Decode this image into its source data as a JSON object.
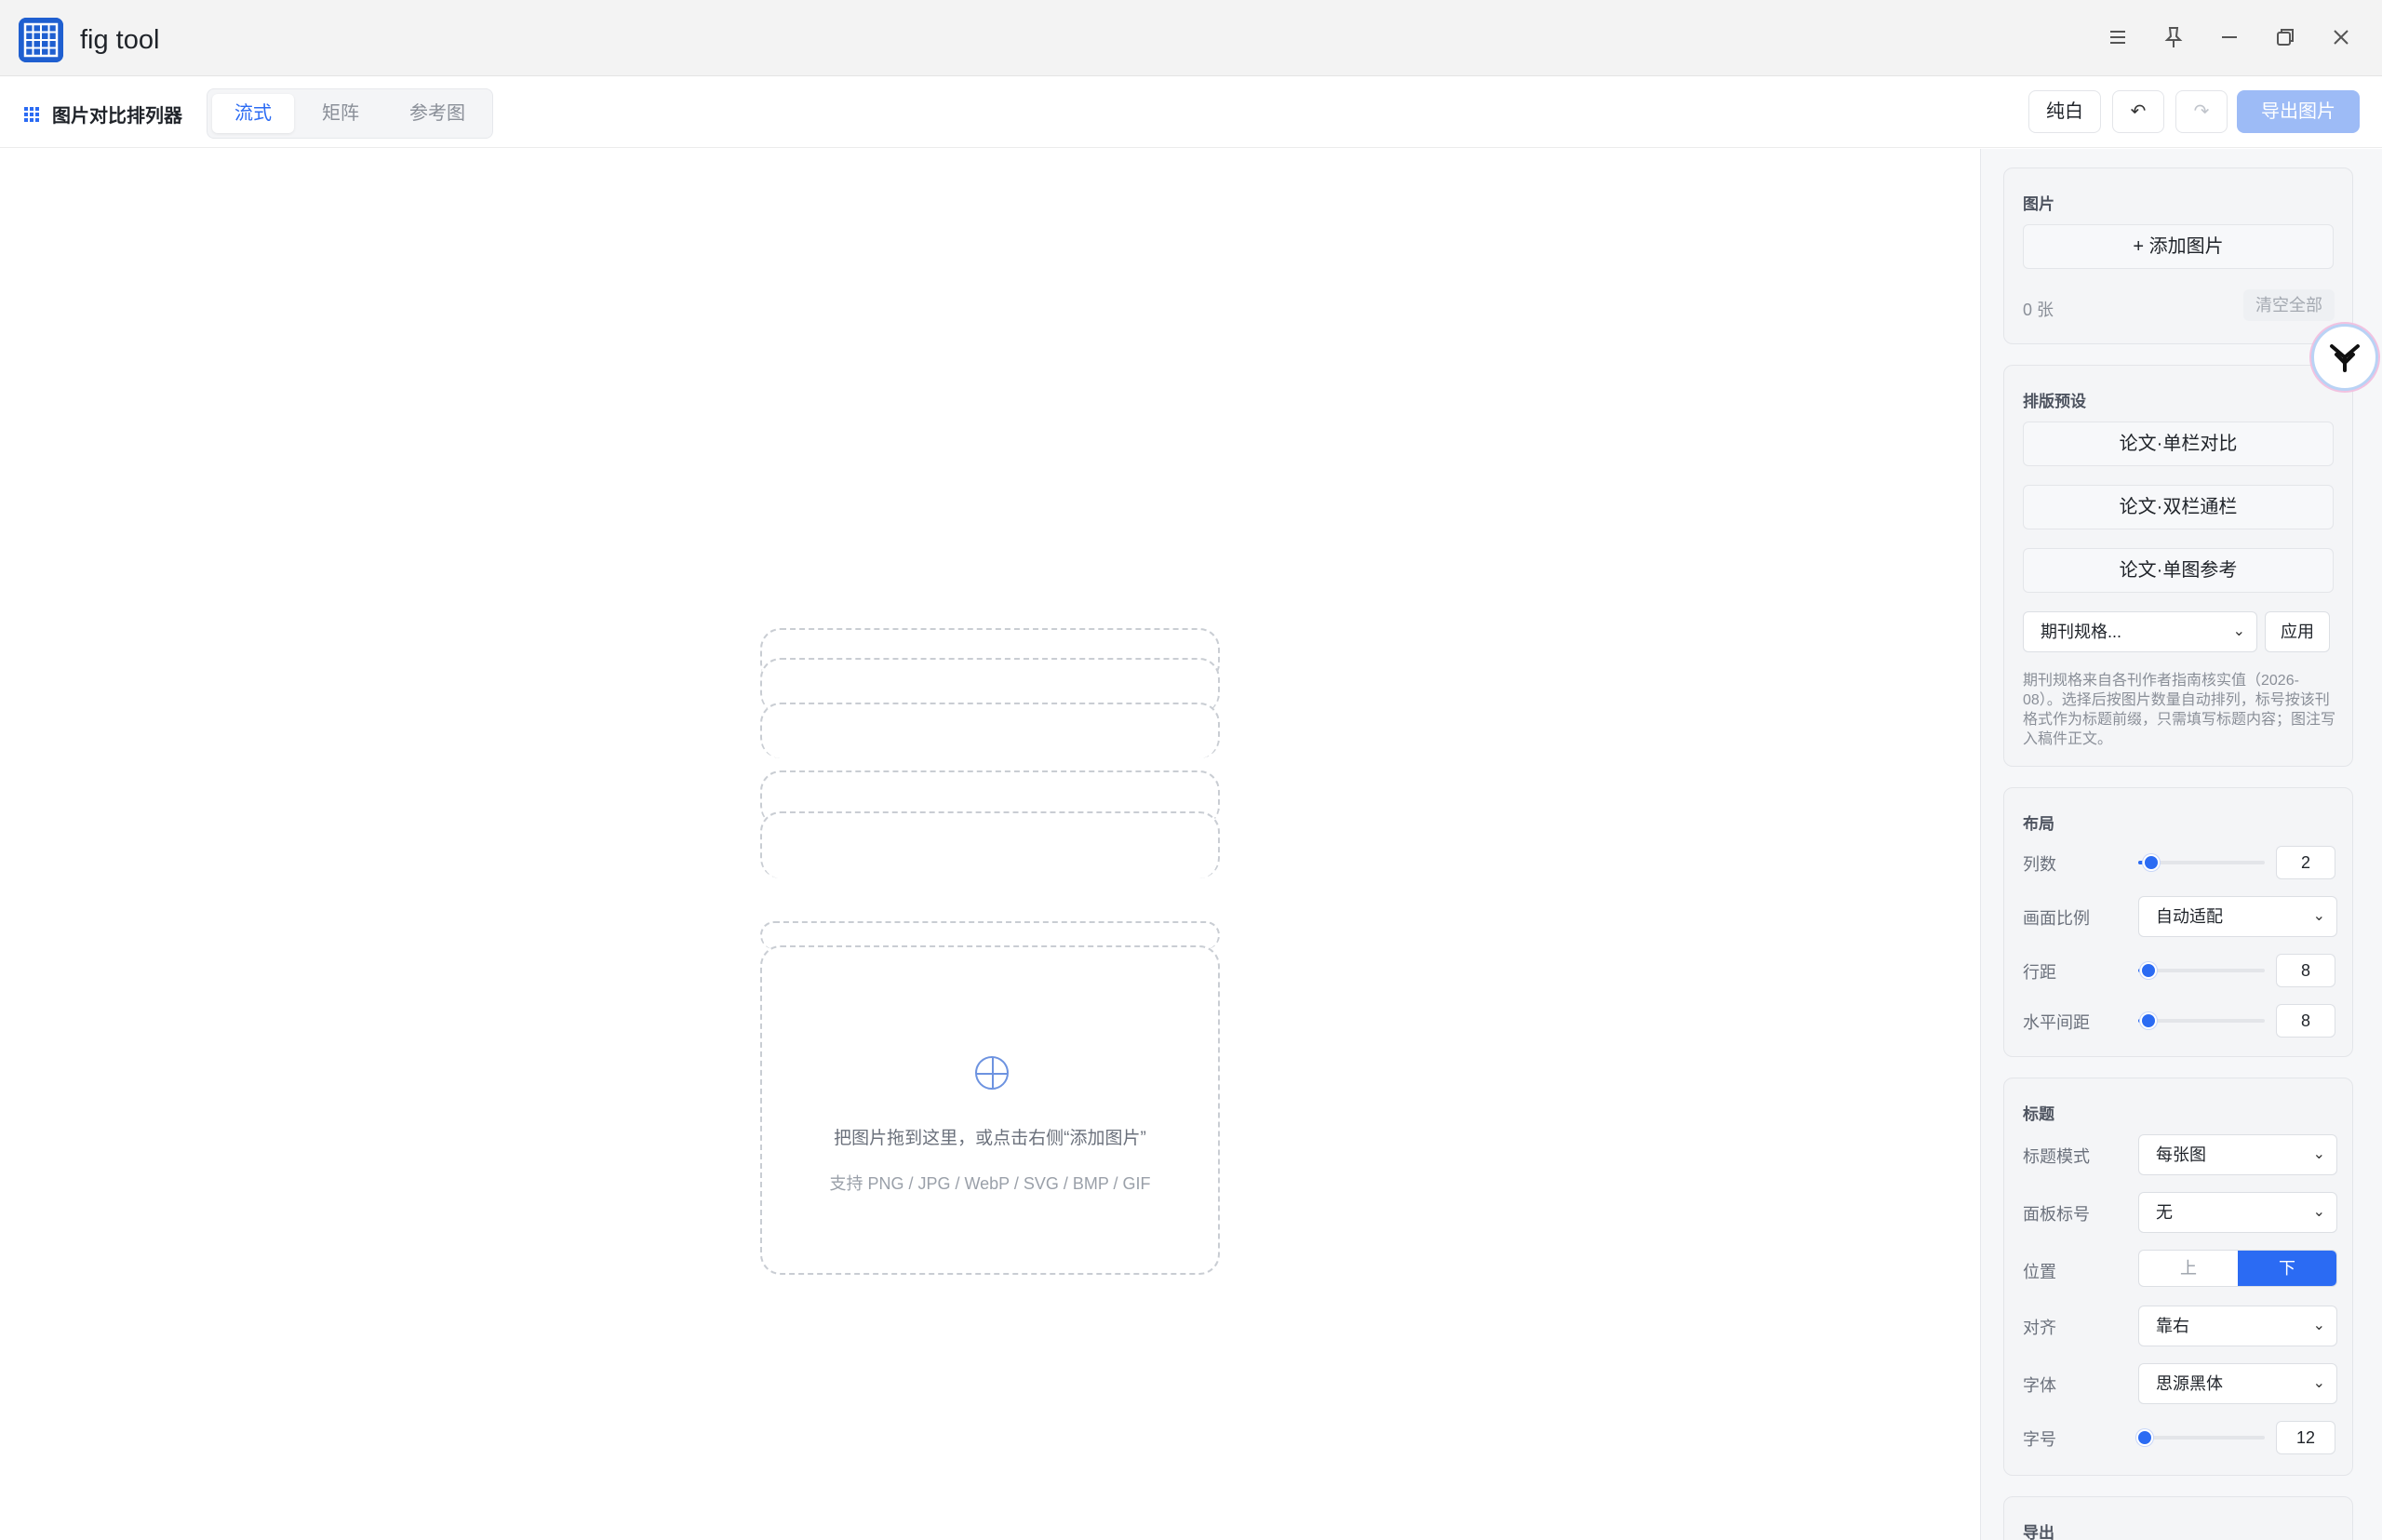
{
  "window": {
    "title": "fig tool",
    "controls": [
      "menu-icon",
      "pin-icon",
      "minimize-icon",
      "restore-icon",
      "close-icon"
    ]
  },
  "toolbar": {
    "brand_label": "图片对比排列器",
    "modes": [
      {
        "label": "流式",
        "active": true
      },
      {
        "label": "矩阵",
        "active": false
      },
      {
        "label": "参考图",
        "active": false
      }
    ],
    "background_label": "纯白",
    "undo_icon": "↶",
    "redo_icon": "↷",
    "export_label": "导出图片"
  },
  "canvas": {
    "drop_main": "把图片拖到这里，或点击右侧“添加图片”",
    "drop_sub": "支持 PNG / JPG / WebP / SVG / BMP / GIF"
  },
  "panel": {
    "images": {
      "title": "图片",
      "add_label": "+ 添加图片",
      "count": "0 张",
      "clear_label": "清空全部"
    },
    "presets": {
      "title": "排版预设",
      "buttons": [
        "论文·单栏对比",
        "论文·双栏通栏",
        "论文·单图参考"
      ],
      "journal_select": "期刊规格...",
      "apply_label": "应用",
      "note": "期刊规格来自各刊作者指南核实值（2026-08）。选择后按图片数量自动排列，标号按该刊格式作为标题前缀，只需填写标题内容；图注写入稿件正文。"
    },
    "layout": {
      "title": "布局",
      "columns_label": "列数",
      "columns_value": "2",
      "columns_level": 0.1,
      "aspect_label": "画面比例",
      "aspect_value": "自动适配",
      "row_gap_label": "行距",
      "row_gap_value": "8",
      "row_gap_level": 0.08,
      "col_gap_label": "水平间距",
      "col_gap_value": "8",
      "col_gap_level": 0.08
    },
    "caption": {
      "title": "标题",
      "mode_label": "标题模式",
      "mode_value": "每张图",
      "panel_label_label": "面板标号",
      "panel_label_value": "无",
      "position_label": "位置",
      "position_options": [
        "上",
        "下"
      ],
      "position_selected": "下",
      "align_label": "对齐",
      "align_value": "靠右",
      "font_label": "字体",
      "font_value": "思源黑体",
      "size_label": "字号",
      "size_value": "12",
      "size_level": 0.05
    },
    "export": {
      "title": "导出"
    }
  },
  "colors": {
    "accent": "#2b6bf3",
    "export_disabled": "#9dbbf6"
  }
}
